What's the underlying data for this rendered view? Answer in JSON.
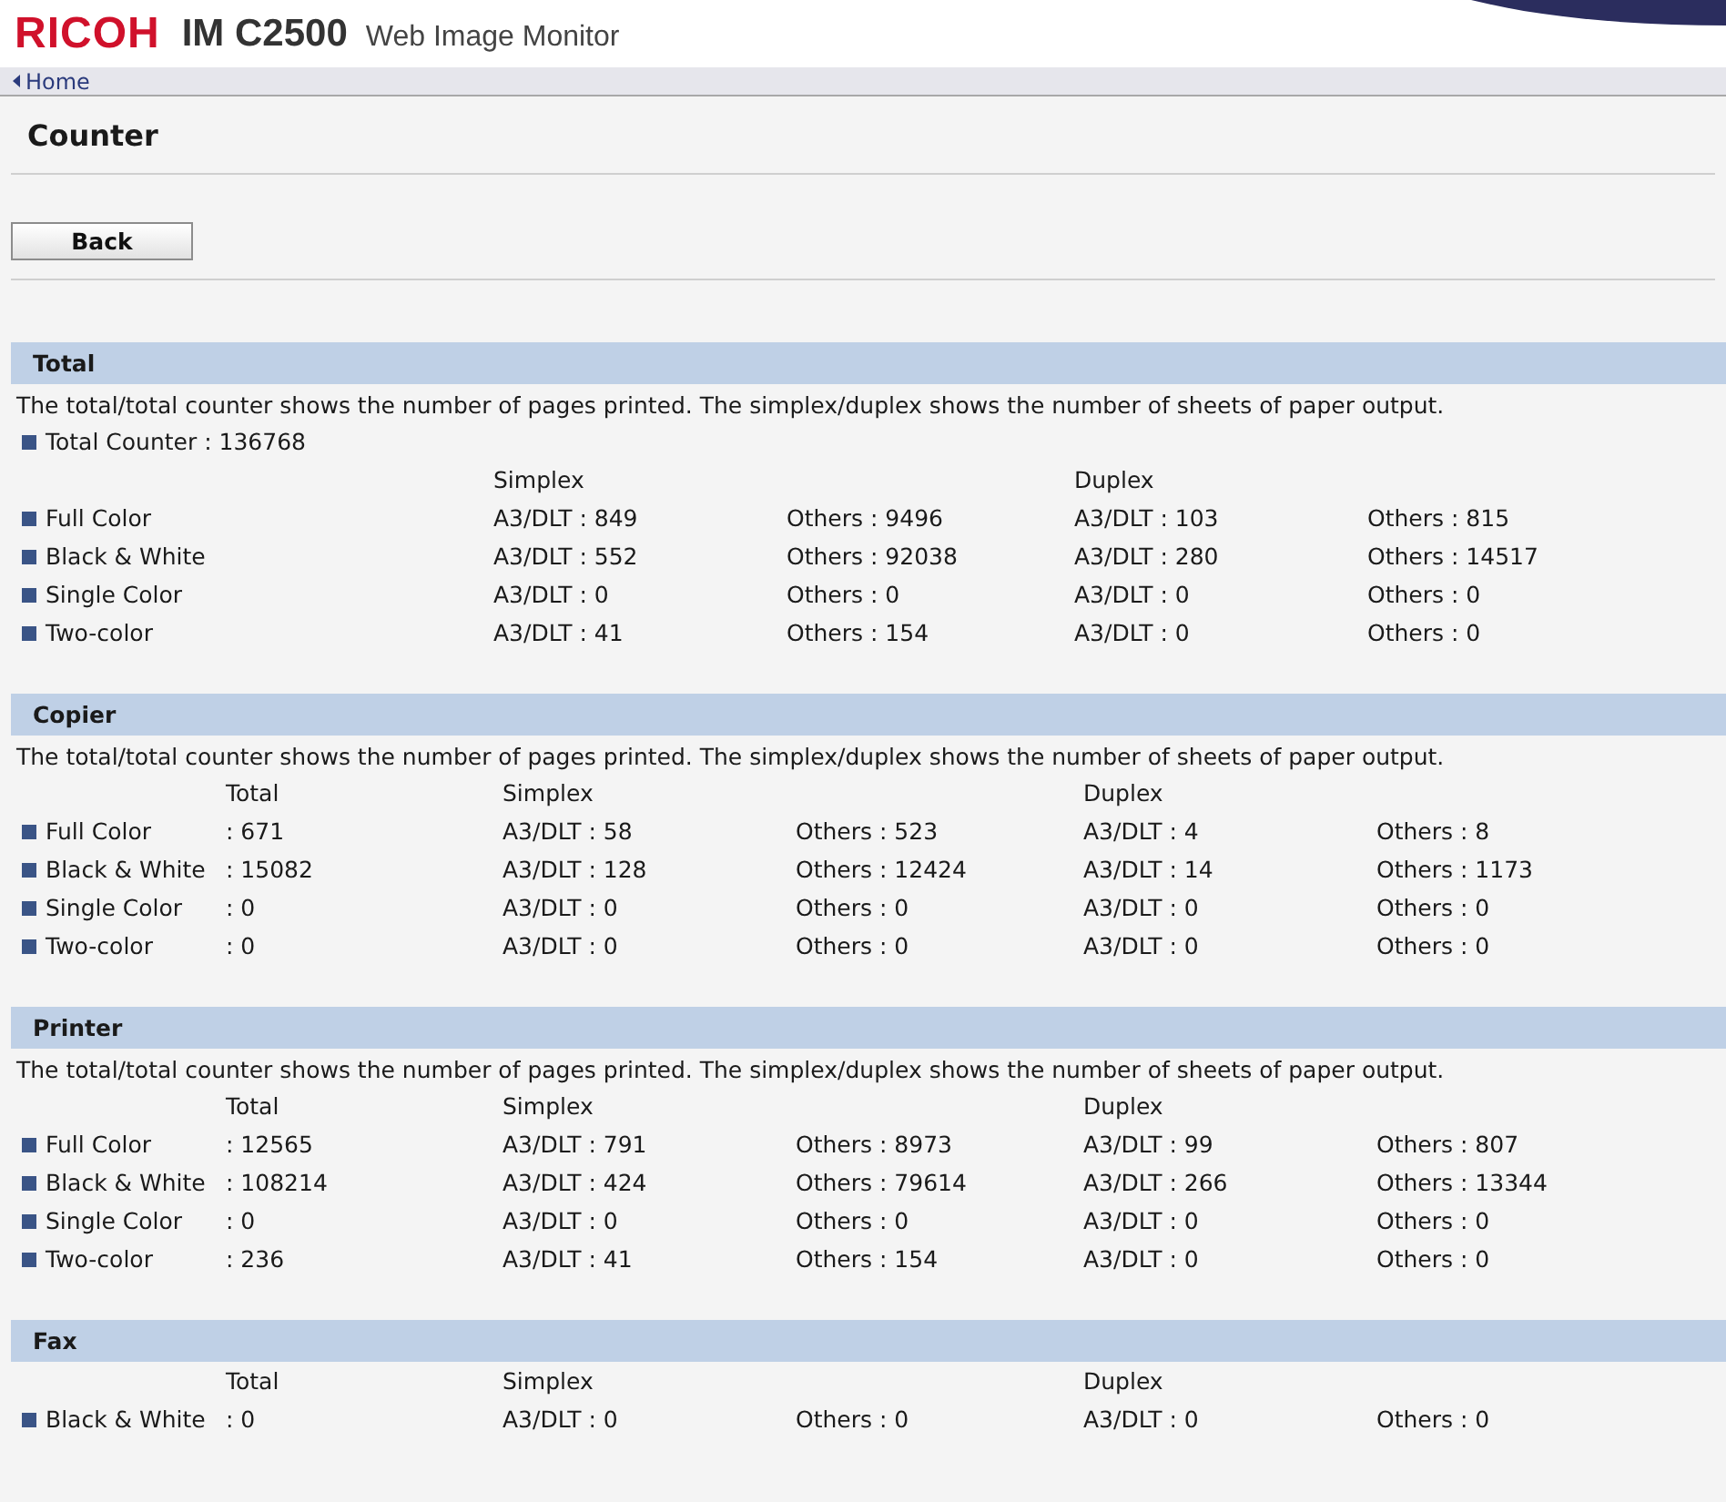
{
  "header": {
    "brand": "RICOH",
    "model": "IM C2500",
    "product": "Web Image Monitor"
  },
  "breadcrumb": {
    "label": "Home"
  },
  "page_title": "Counter",
  "back_button": "Back",
  "sections": [
    {
      "title": "Total",
      "note": "The total/total counter shows the number of pages printed. The simplex/duplex shows the number of sheets of paper output.",
      "total_counter": "Total Counter : 136768",
      "headers": {
        "simplex": "Simplex",
        "duplex": "Duplex"
      },
      "rows": [
        {
          "label": "Full Color",
          "simplex_a3": "A3/DLT : 849",
          "simplex_others": "Others : 9496",
          "duplex_a3": "A3/DLT : 103",
          "duplex_others": "Others : 815"
        },
        {
          "label": "Black & White",
          "simplex_a3": "A3/DLT : 552",
          "simplex_others": "Others : 92038",
          "duplex_a3": "A3/DLT : 280",
          "duplex_others": "Others : 14517"
        },
        {
          "label": "Single Color",
          "simplex_a3": "A3/DLT : 0",
          "simplex_others": "Others : 0",
          "duplex_a3": "A3/DLT : 0",
          "duplex_others": "Others : 0"
        },
        {
          "label": "Two-color",
          "simplex_a3": "A3/DLT : 41",
          "simplex_others": "Others : 154",
          "duplex_a3": "A3/DLT : 0",
          "duplex_others": "Others : 0"
        }
      ]
    },
    {
      "title": "Copier",
      "note": "The total/total counter shows the number of pages printed. The simplex/duplex shows the number of sheets of paper output.",
      "headers": {
        "total": "Total",
        "simplex": "Simplex",
        "duplex": "Duplex"
      },
      "rows": [
        {
          "label": "Full Color",
          "total": ": 671",
          "simplex_a3": "A3/DLT : 58",
          "simplex_others": "Others : 523",
          "duplex_a3": "A3/DLT : 4",
          "duplex_others": "Others : 8"
        },
        {
          "label": "Black & White",
          "total": ": 15082",
          "simplex_a3": "A3/DLT : 128",
          "simplex_others": "Others : 12424",
          "duplex_a3": "A3/DLT : 14",
          "duplex_others": "Others : 1173"
        },
        {
          "label": "Single Color",
          "total": ": 0",
          "simplex_a3": "A3/DLT : 0",
          "simplex_others": "Others : 0",
          "duplex_a3": "A3/DLT : 0",
          "duplex_others": "Others : 0"
        },
        {
          "label": "Two-color",
          "total": ": 0",
          "simplex_a3": "A3/DLT : 0",
          "simplex_others": "Others : 0",
          "duplex_a3": "A3/DLT : 0",
          "duplex_others": "Others : 0"
        }
      ]
    },
    {
      "title": "Printer",
      "note": "The total/total counter shows the number of pages printed. The simplex/duplex shows the number of sheets of paper output.",
      "headers": {
        "total": "Total",
        "simplex": "Simplex",
        "duplex": "Duplex"
      },
      "rows": [
        {
          "label": "Full Color",
          "total": ": 12565",
          "simplex_a3": "A3/DLT : 791",
          "simplex_others": "Others : 8973",
          "duplex_a3": "A3/DLT : 99",
          "duplex_others": "Others : 807"
        },
        {
          "label": "Black & White",
          "total": ": 108214",
          "simplex_a3": "A3/DLT : 424",
          "simplex_others": "Others : 79614",
          "duplex_a3": "A3/DLT : 266",
          "duplex_others": "Others : 13344"
        },
        {
          "label": "Single Color",
          "total": ": 0",
          "simplex_a3": "A3/DLT : 0",
          "simplex_others": "Others : 0",
          "duplex_a3": "A3/DLT : 0",
          "duplex_others": "Others : 0"
        },
        {
          "label": "Two-color",
          "total": ": 236",
          "simplex_a3": "A3/DLT : 41",
          "simplex_others": "Others : 154",
          "duplex_a3": "A3/DLT : 0",
          "duplex_others": "Others : 0"
        }
      ]
    },
    {
      "title": "Fax",
      "headers": {
        "total": "Total",
        "simplex": "Simplex",
        "duplex": "Duplex"
      },
      "rows": [
        {
          "label": "Black & White",
          "total": ": 0",
          "simplex_a3": "A3/DLT : 0",
          "simplex_others": "Others : 0",
          "duplex_a3": "A3/DLT : 0",
          "duplex_others": "Others : 0"
        }
      ]
    }
  ]
}
